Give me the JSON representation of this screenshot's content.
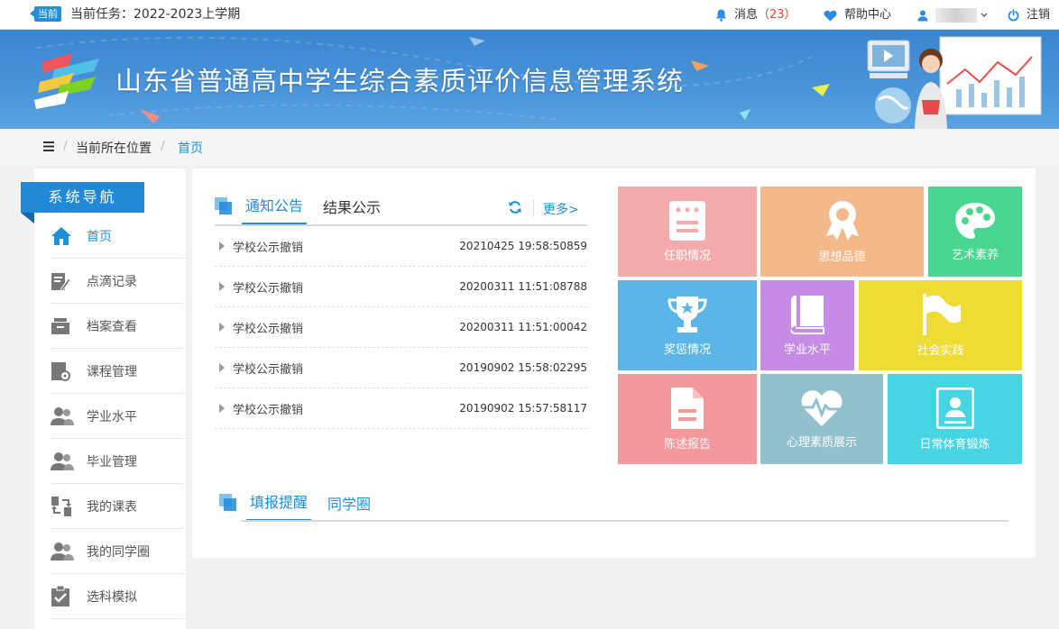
{
  "topbar": {
    "badge": "当前",
    "task": "当前任务：2022-2023上学期",
    "messages_label": "消息",
    "messages_count": "（23）",
    "help_label": "帮助中心",
    "logout_label": "注销"
  },
  "banner": {
    "title": "山东省普通高中学生综合素质评价信息管理系统"
  },
  "breadcrumb": {
    "location_label": "当前所在位置",
    "current": "首页"
  },
  "sidebar": {
    "heading": "系统导航",
    "items": [
      {
        "label": "首页",
        "icon": "home-icon"
      },
      {
        "label": "点滴记录",
        "icon": "edit-icon"
      },
      {
        "label": "档案查看",
        "icon": "archive-box-icon"
      },
      {
        "label": "课程管理",
        "icon": "course-settings-icon"
      },
      {
        "label": "学业水平",
        "icon": "users-icon"
      },
      {
        "label": "毕业管理",
        "icon": "users-icon"
      },
      {
        "label": "我的课表",
        "icon": "swap-icon"
      },
      {
        "label": "我的同学圈",
        "icon": "users-icon"
      },
      {
        "label": "选科模拟",
        "icon": "clipboard-check-icon"
      }
    ]
  },
  "notices": {
    "tabs": [
      "通知公告",
      "结果公示"
    ],
    "more_label": "更多>",
    "items": [
      {
        "title": "学校公示撤销",
        "date": "20210425 19:58:50859"
      },
      {
        "title": "学校公示撤销",
        "date": "20200311 11:51:08788"
      },
      {
        "title": "学校公示撤销",
        "date": "20200311 11:51:00042"
      },
      {
        "title": "学校公示撤销",
        "date": "20190902 15:58:02295"
      },
      {
        "title": "学校公示撤销",
        "date": "20190902 15:57:58117"
      }
    ]
  },
  "tiles": [
    {
      "label": "任职情况",
      "color": "#f4a9ab",
      "icon": "document-list-icon"
    },
    {
      "label": "思想品德",
      "color": "#f4b98a",
      "icon": "medal-icon"
    },
    {
      "label": "艺术素养",
      "color": "#49d68f",
      "icon": "palette-icon"
    },
    {
      "label": "奖惩情况",
      "color": "#5bb5e6",
      "icon": "trophy-icon"
    },
    {
      "label": "学业水平",
      "color": "#c58be6",
      "icon": "book-icon"
    },
    {
      "label": "社会实践",
      "color": "#eedb34",
      "icon": "flag-icon"
    },
    {
      "label": "陈述报告",
      "color": "#f4989b",
      "icon": "file-report-icon"
    },
    {
      "label": "心理素质展示",
      "color": "#93c0cd",
      "icon": "heartbeat-icon"
    },
    {
      "label": "日常体育锻炼",
      "color": "#48d4e2",
      "icon": "id-card-icon"
    }
  ],
  "reminders": {
    "tabs": [
      "填报提醒",
      "同学圈"
    ]
  }
}
